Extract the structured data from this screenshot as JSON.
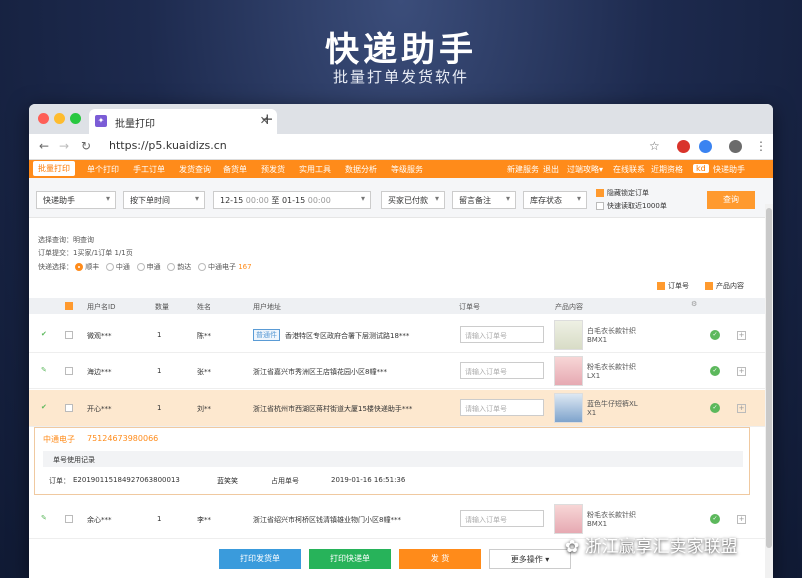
{
  "hero": {
    "title": "快递助手",
    "subtitle": "批量打单发货软件"
  },
  "browser": {
    "tab_title": "批量打印",
    "url": "https://p5.kuaidizs.cn"
  },
  "menu": {
    "items": [
      "批量打印",
      "单个打印",
      "手工订单",
      "发货查询",
      "备货单",
      "预发货",
      "实用工具",
      "数据分析",
      "等级服务"
    ],
    "right": [
      "新建服务",
      "退出",
      "过端攻略▾",
      "在线联系",
      "近期资格",
      "快递助手"
    ]
  },
  "filters": {
    "shop": "快递助手",
    "time": "按下单时间",
    "date_start": "12-15",
    "time_start": "00:00",
    "date_sep": "至",
    "date_end": "01-15",
    "time_end": "00:00",
    "pay": "买家已付款",
    "remark": "留言备注",
    "stock": "库存状态",
    "opt1": "隐藏锁定订单",
    "opt2": "快速读取近1000单",
    "search": "查询"
  },
  "summary": {
    "line1": "选择查询：明查询",
    "line2": "订单提交：1买家/1订单  1/1页",
    "carrier_label": "快递选择：",
    "carriers": [
      "顺丰",
      "中通",
      "申通",
      "韵达",
      "中通电子"
    ],
    "count": "167",
    "toggle1": "订单号",
    "toggle2": "产品内容"
  },
  "table": {
    "headers": [
      "用户名ID",
      "数量",
      "姓名",
      "用户地址",
      "订单号",
      "产品内容"
    ],
    "rows": [
      {
        "user": "微观***",
        "qty": "1",
        "name": "陈**",
        "tag": "普通件",
        "addr": "香港特区专区政府合署下层测试路18***",
        "placeholder": "请输入订单号",
        "product": "白毛衣长款针织BMX1"
      },
      {
        "user": "海边***",
        "qty": "1",
        "name": "张**",
        "addr": "浙江省嘉兴市秀洲区王店镇花园小区8幢***",
        "placeholder": "请输入订单号",
        "product": "粉毛衣长款针织LX1"
      },
      {
        "user": "开心***",
        "qty": "1",
        "name": "刘**",
        "addr": "浙江省杭州市西湖区蒋村街道大厦15楼快递助手***",
        "placeholder": "请输入订单号",
        "product": "蓝色牛仔短裤XL X1"
      },
      {
        "user": "余心***",
        "qty": "1",
        "name": "李**",
        "addr": "浙江省绍兴市柯桥区钱清镇雄业物门小区8幢***",
        "placeholder": "请输入订单号",
        "product": "粉毛衣长款针织BMX1"
      }
    ]
  },
  "panel": {
    "carrier": "中通电子",
    "number": "75124673980066",
    "section": "单号使用记录",
    "order_label": "订单：",
    "order_no": "E20190115184927063800013",
    "status": "蓝笑笑",
    "used_label": "占用单号",
    "datetime": "2019-01-16 16:51:36"
  },
  "buttons": {
    "print_express": "打印发货单",
    "print_waybill": "打印快递单",
    "ship": "发 货",
    "more": "更多操作 ▾"
  },
  "watermark": "浙江赢享汇卖家联盟",
  "colors": {
    "accent": "#ff8b1a",
    "bg": "#1d2a4e"
  }
}
